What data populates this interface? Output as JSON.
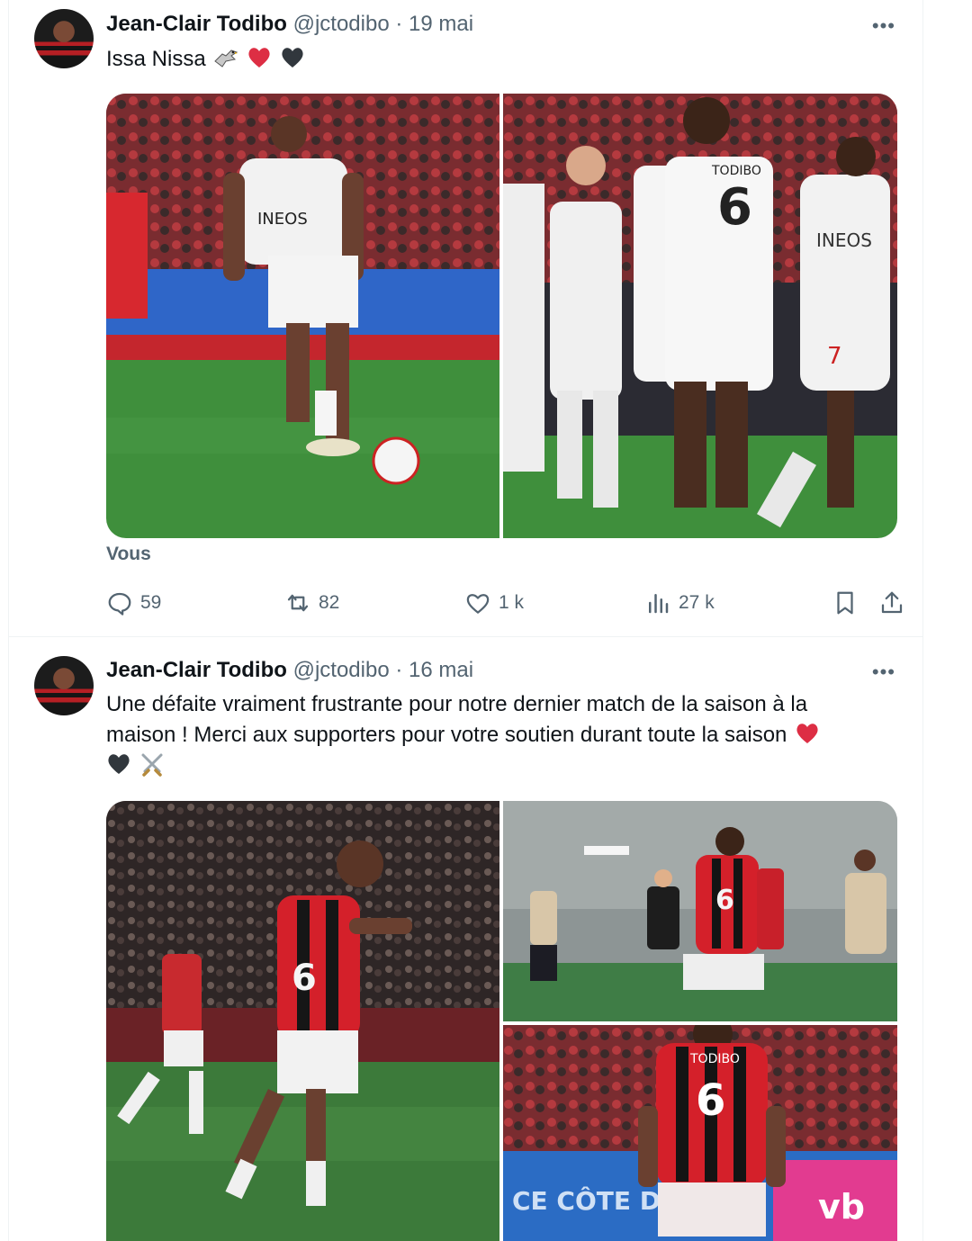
{
  "tweets": [
    {
      "author_name": "Jean-Clair Todibo",
      "handle": "@jctodibo",
      "separator": "·",
      "date": "19 mai",
      "more_label": "•••",
      "text": "Issa Nissa",
      "emojis": [
        "eagle-icon",
        "red-heart-icon",
        "black-heart-icon"
      ],
      "tagged_label": "Vous",
      "stats": {
        "replies": "59",
        "reposts": "82",
        "likes": "1 k",
        "views": "27 k"
      },
      "photos": [
        {
          "name": "photo-player-ball",
          "desc_icon": "photo"
        },
        {
          "name": "photo-team-celebration",
          "desc_icon": "photo"
        }
      ]
    },
    {
      "author_name": "Jean-Clair Todibo",
      "handle": "@jctodibo",
      "separator": "·",
      "date": "16 mai",
      "more_label": "•••",
      "text_line1": "Une défaite vraiment frustrante pour notre dernier match de la saison à la",
      "text_line2": "maison ! Merci aux supporters pour votre soutien durant toute la saison",
      "emojis": [
        "red-heart-icon",
        "black-heart-icon",
        "crossed-swords-icon"
      ],
      "photos": [
        {
          "name": "photo-player-running"
        },
        {
          "name": "photo-match-smoke"
        },
        {
          "name": "photo-player-back-6"
        }
      ]
    }
  ],
  "colors": {
    "text_primary": "#0f1419",
    "text_secondary": "#536471",
    "border": "#eff3f4",
    "nice_red": "#d4202a",
    "pitch_green": "#3f8f3c"
  }
}
